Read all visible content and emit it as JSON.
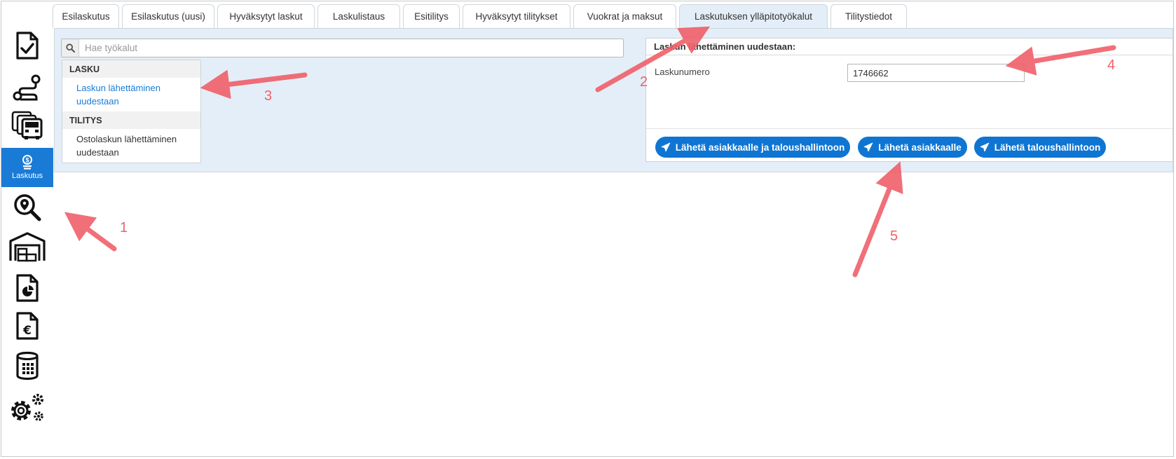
{
  "sidebar": {
    "items": [
      {
        "icon": "document-check-icon",
        "label": ""
      },
      {
        "icon": "route-icon",
        "label": ""
      },
      {
        "icon": "trucks-icon",
        "label": ""
      },
      {
        "icon": "money-bag-icon",
        "label": "Laskutus",
        "active": true
      },
      {
        "icon": "map-search-icon",
        "label": ""
      },
      {
        "icon": "warehouse-icon",
        "label": ""
      },
      {
        "icon": "report-icon",
        "label": ""
      },
      {
        "icon": "euro-document-icon",
        "label": ""
      },
      {
        "icon": "database-icon",
        "label": ""
      },
      {
        "icon": "gears-icon",
        "label": ""
      }
    ],
    "accent": "#1a7bd6"
  },
  "tabs": [
    {
      "label": "Esilaskutus"
    },
    {
      "label": "Esilaskutus (uusi)"
    },
    {
      "label": "Hyväksytyt laskut"
    },
    {
      "label": "Laskulistaus"
    },
    {
      "label": "Esitilitys"
    },
    {
      "label": "Hyväksytyt tilitykset"
    },
    {
      "label": "Vuokrat ja maksut"
    },
    {
      "label": "Laskutuksen ylläpitotyökalut",
      "active": true
    },
    {
      "label": "Tilitystiedot"
    }
  ],
  "search": {
    "placeholder": "Hae työkalut",
    "value": ""
  },
  "tool_menu": {
    "groups": [
      {
        "title": "LASKU",
        "items": [
          "Laskun lähettäminen uudestaan"
        ]
      },
      {
        "title": "TILITYS",
        "items": [
          "Ostolaskun lähettäminen uudestaan"
        ]
      }
    ]
  },
  "form": {
    "title": "Laskun lähettäminen uudestaan:",
    "invoice_label": "Laskunumero",
    "invoice_value": "1746662",
    "buttons": [
      {
        "label": "Lähetä asiakkaalle ja taloushallintoon"
      },
      {
        "label": "Lähetä asiakkaalle"
      },
      {
        "label": "Lähetä taloushallintoon"
      }
    ]
  },
  "annotations": {
    "color": "#f0606a",
    "labels": [
      "1",
      "2",
      "3",
      "4",
      "5"
    ]
  },
  "colors": {
    "panel_bg": "#e4eef8",
    "button_bg": "#0f75d2",
    "link": "#1a7bd6"
  }
}
